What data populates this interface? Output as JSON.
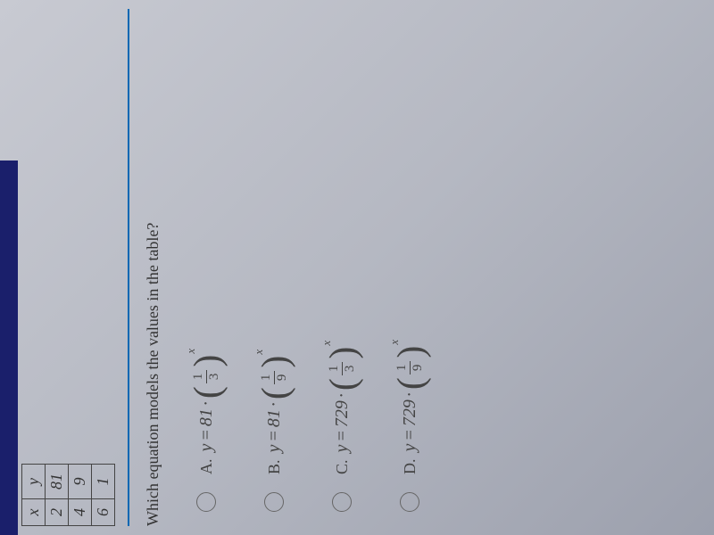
{
  "table": {
    "headers": [
      "x",
      "y"
    ],
    "rows": [
      [
        "2",
        "81"
      ],
      [
        "4",
        "9"
      ],
      [
        "6",
        "1"
      ]
    ]
  },
  "question": "Which equation models the values in the table?",
  "options": [
    {
      "letter": "A.",
      "coeff": "81",
      "frac_num": "1",
      "frac_den": "3",
      "exp": "x"
    },
    {
      "letter": "B.",
      "coeff": "81",
      "frac_num": "1",
      "frac_den": "9",
      "exp": "x"
    },
    {
      "letter": "C.",
      "coeff": "729",
      "frac_num": "1",
      "frac_den": "3",
      "exp": "x"
    },
    {
      "letter": "D.",
      "coeff": "729",
      "frac_num": "1",
      "frac_den": "9",
      "exp": "x"
    }
  ],
  "lhs": "y",
  "eq": "=",
  "dot": "·"
}
